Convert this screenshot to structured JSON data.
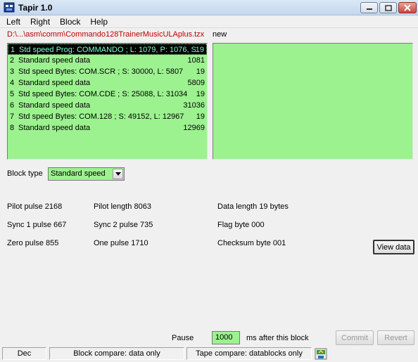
{
  "window": {
    "title": "Tapir 1.0"
  },
  "menu": [
    "Left",
    "Right",
    "Block",
    "Help"
  ],
  "left_panel": {
    "file_path": "D:\\...\\asm\\comm\\Commando128TrainerMusicULAplus.tzx",
    "blocks": [
      {
        "num": "1",
        "desc": "Std speed Prog: COMMANDO  ; L: 1079, P: 1076, S",
        "val": "19",
        "selected": true
      },
      {
        "num": "2",
        "desc": "Standard speed data",
        "val": "1081"
      },
      {
        "num": "3",
        "desc": "Std speed Bytes: COM.SCR   ; S: 30000, L: 5807",
        "val": "19"
      },
      {
        "num": "4",
        "desc": "Standard speed data",
        "val": "5809"
      },
      {
        "num": "5",
        "desc": "Std speed Bytes: COM.CDE   ; S: 25088, L: 31034",
        "val": "19"
      },
      {
        "num": "6",
        "desc": "Standard speed data",
        "val": "31036"
      },
      {
        "num": "7",
        "desc": "Std speed Bytes: COM.128   ; S: 49152, L: 12967",
        "val": "19"
      },
      {
        "num": "8",
        "desc": "Standard speed data",
        "val": "12969"
      }
    ]
  },
  "right_panel": {
    "label": "new"
  },
  "block_type": {
    "label": "Block type",
    "value": "Standard speed"
  },
  "params": {
    "pilot_pulse": "Pilot pulse 2168",
    "pilot_length": "Pilot length 8063",
    "data_length": "Data length 19 bytes",
    "sync1": "Sync 1 pulse 667",
    "sync2": "Sync 2 pulse 735",
    "flag_byte": "Flag byte 000",
    "zero_pulse": "Zero pulse 855",
    "one_pulse": "One pulse 1710",
    "checksum": "Checksum byte 001"
  },
  "buttons": {
    "view_data": "View data",
    "commit": "Commit",
    "revert": "Revert"
  },
  "pause": {
    "label": "Pause",
    "value": "1000",
    "suffix": "ms after this block"
  },
  "status": {
    "mode": "Dec",
    "block_compare": "Block compare: data only",
    "tape_compare": "Tape compare: datablocks only"
  },
  "colors": {
    "list_bg": "#9cf28f",
    "path_red": "#c00000",
    "selected_fg": "#7fffd4"
  }
}
